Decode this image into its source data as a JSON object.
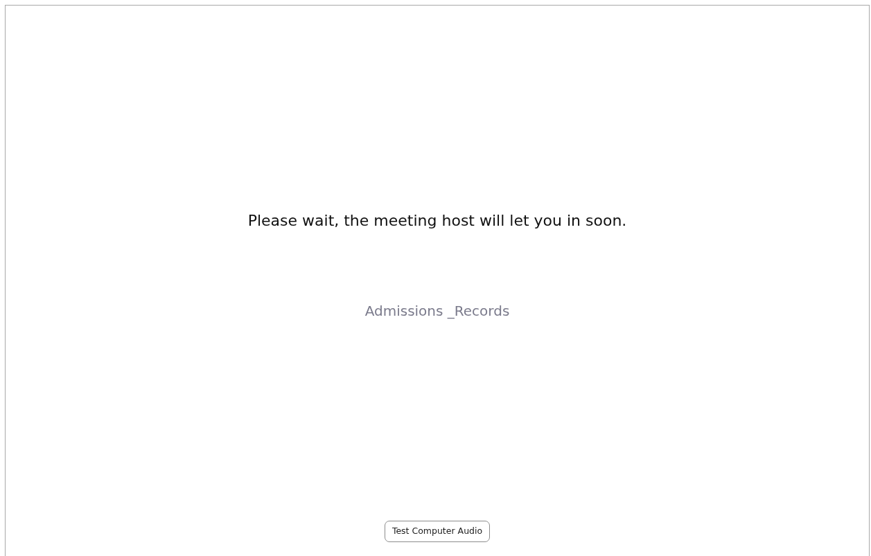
{
  "message": "Please wait, the meeting host will let you in soon.",
  "meeting_name": "Admissions _Records",
  "buttons": [
    {
      "label": "Test Computer Audio"
    }
  ]
}
